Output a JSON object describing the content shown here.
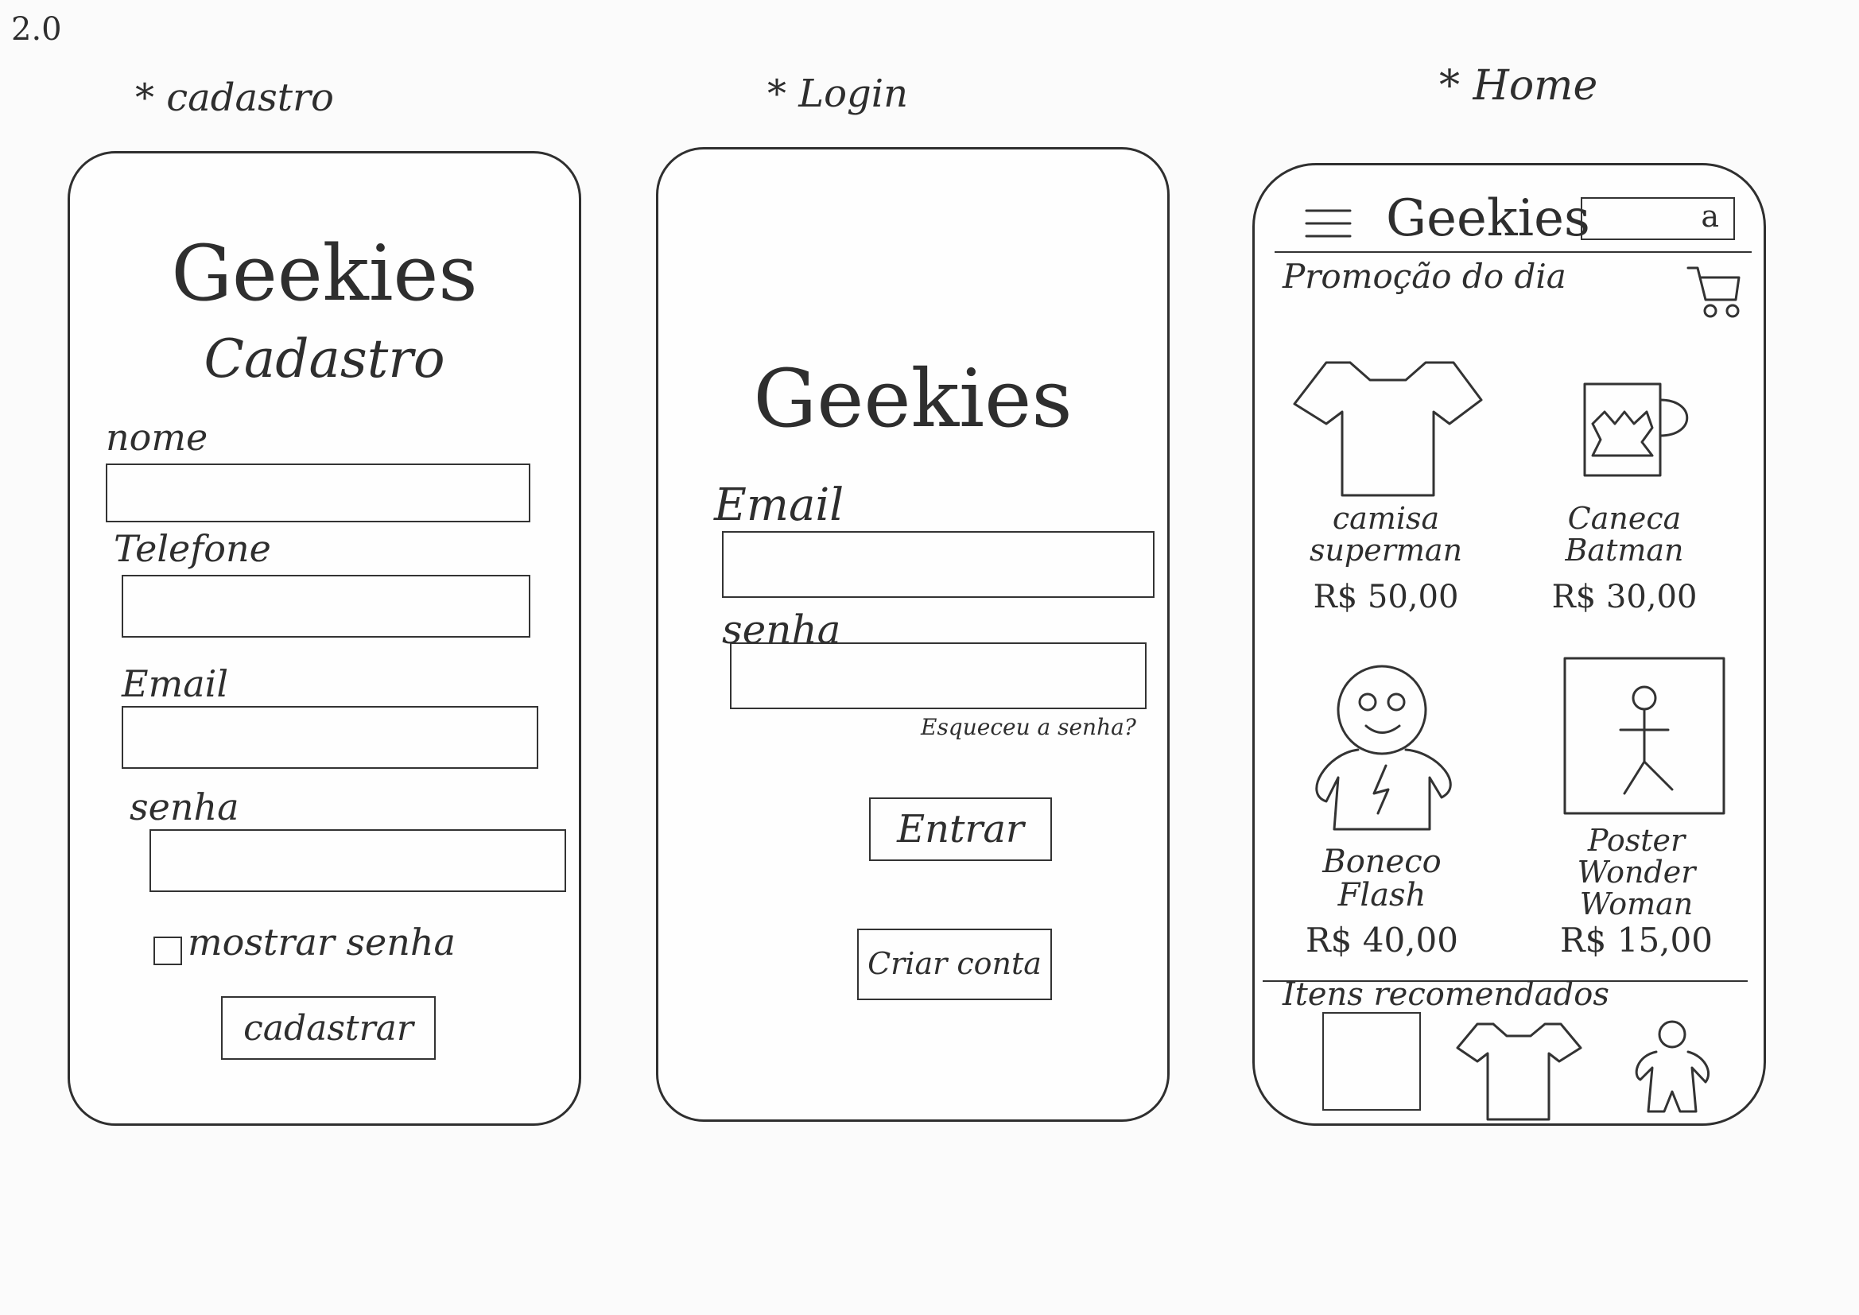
{
  "sheet": {
    "version": "2.0"
  },
  "cadastro": {
    "caption": "* cadastro",
    "brand": "Geekies",
    "title": "Cadastro",
    "labels": {
      "nome": "nome",
      "telefone": "Telefone",
      "email": "Email",
      "senha": "senha"
    },
    "show_password": "mostrar senha",
    "submit": "cadastrar"
  },
  "login": {
    "caption": "* Login",
    "brand": "Geekies",
    "labels": {
      "email": "Email",
      "senha": "senha"
    },
    "forgot": "Esqueceu a senha?",
    "enter": "Entrar",
    "create": "Criar conta"
  },
  "home": {
    "caption": "* Home",
    "brand": "Geekies",
    "search_icon_letter": "a",
    "promo_title": "Promoção do dia",
    "products": [
      {
        "name": "camisa superman",
        "price": "R$ 50,00",
        "icon": "tshirt-icon"
      },
      {
        "name": "Caneca Batman",
        "price": "R$ 30,00",
        "icon": "mug-icon"
      },
      {
        "name": "Boneco Flash",
        "price": "R$ 40,00",
        "icon": "doll-icon"
      },
      {
        "name": "Poster Wonder Woman",
        "price": "R$ 15,00",
        "icon": "poster-icon"
      }
    ],
    "recommended_title": "Itens recomendados"
  }
}
